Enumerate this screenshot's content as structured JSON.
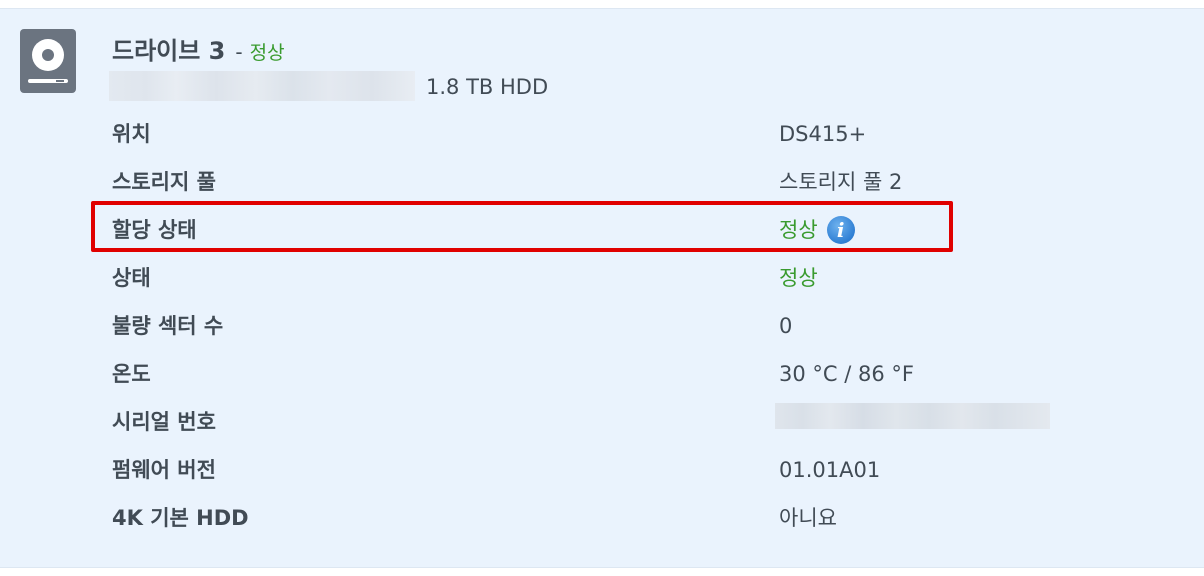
{
  "drive": {
    "icon": "hard-disk-icon",
    "name": "드라이브 3",
    "separator": "-",
    "status": "정상",
    "capacity": "1.8 TB HDD"
  },
  "details": {
    "location": {
      "label": "위치",
      "value": "DS415+"
    },
    "storage_pool": {
      "label": "스토리지 풀",
      "value": "스토리지 풀 2"
    },
    "allocation_status": {
      "label": "할당 상태",
      "value": "정상",
      "info_icon": "i"
    },
    "health_status": {
      "label": "상태",
      "value": "정상"
    },
    "bad_sectors": {
      "label": "불량 섹터 수",
      "value": "0"
    },
    "temperature": {
      "label": "온도",
      "value": "30 °C / 86 °F"
    },
    "serial_number": {
      "label": "시리얼 번호"
    },
    "firmware": {
      "label": "펌웨어 버전",
      "value": "01.01A01"
    },
    "native_4k": {
      "label": "4K 기본 HDD",
      "value": "아니요"
    }
  },
  "colors": {
    "panel_background": "#eaf3fd",
    "text": "#414b55",
    "status_ok": "#3a9b2f",
    "highlight": "#e00000",
    "info_icon": "#2f7fd4"
  }
}
